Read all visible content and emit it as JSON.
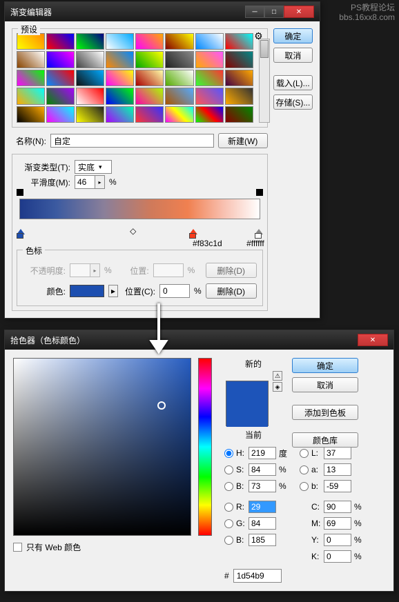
{
  "watermark": {
    "line1": "PS教程论坛",
    "line2": "bbs.16xx8.com"
  },
  "gradient_editor": {
    "title": "渐变编辑器",
    "presets_label": "预设",
    "buttons": {
      "ok": "确定",
      "cancel": "取消",
      "load": "载入(L)...",
      "save": "存储(S)..."
    },
    "name_label": "名称(N):",
    "name_value": "自定",
    "new_button": "新建(W)",
    "type_label": "渐变类型(T):",
    "type_value": "实底",
    "smooth_label": "平滑度(M):",
    "smooth_value": "46",
    "smooth_unit": "%",
    "stops_label": "色标",
    "annotations": {
      "red": "#f83c1d",
      "white": "#ffffff"
    },
    "opacity_label": "不透明度:",
    "opacity_unit": "%",
    "position_label": "位置:",
    "position_unit": "%",
    "delete1": "删除(D)",
    "color_label": "颜色:",
    "color_value": "#1d4fb0",
    "location_label": "位置(C):",
    "location_value": "0",
    "location_unit": "%",
    "delete2": "删除(D)",
    "preset_colors": [
      "linear-gradient(45deg,#ff0,#f80)",
      "linear-gradient(45deg,#f00,#00f)",
      "linear-gradient(45deg,#0f0,#008)",
      "linear-gradient(45deg,#fff,#0af)",
      "linear-gradient(45deg,#f0f,#fa0)",
      "linear-gradient(45deg,#800,#ff0)",
      "linear-gradient(45deg,#08f,#fff)",
      "linear-gradient(45deg,#f00,#0ff)",
      "linear-gradient(45deg,#840,#fff)",
      "linear-gradient(45deg,#00f,#f0f)",
      "linear-gradient(45deg,#444,#fff)",
      "linear-gradient(45deg,#f80,#08f)",
      "linear-gradient(45deg,#0a0,#ff0)",
      "linear-gradient(45deg,#222,#888)",
      "linear-gradient(45deg,#fa0,#f5f)",
      "linear-gradient(45deg,#800,#088)",
      "linear-gradient(45deg,#f0f,#0f0)",
      "linear-gradient(45deg,#08f,#f00)",
      "linear-gradient(45deg,#111,#0af)",
      "linear-gradient(45deg,#f0f,#ff0)",
      "linear-gradient(45deg,#a00,#ffa)",
      "linear-gradient(45deg,#5a0,#fff)",
      "linear-gradient(45deg,#3f3,#f33)",
      "linear-gradient(45deg,#404,#fa0)",
      "linear-gradient(45deg,#fa0,#0ff)",
      "linear-gradient(45deg,#080,#a0f)",
      "linear-gradient(45deg,#fff,#f00)",
      "linear-gradient(45deg,#00f,#0f0)",
      "linear-gradient(45deg,#f0a,#af0)",
      "linear-gradient(45deg,#a50,#5af)",
      "linear-gradient(45deg,#f55,#55f)",
      "linear-gradient(45deg,#fa0,#333)",
      "linear-gradient(45deg,#000,#fa0)",
      "linear-gradient(45deg,#f0f,#0ff)",
      "linear-gradient(45deg,#ff0,#222)",
      "linear-gradient(45deg,#a0f,#0fa)",
      "linear-gradient(45deg,#f33,#33f)",
      "linear-gradient(45deg,#f0f,#ff0,#0ff)",
      "linear-gradient(45deg,#0f0,#f00,#00f)",
      "linear-gradient(45deg,#800,#080)"
    ]
  },
  "color_picker": {
    "title": "拾色器（色标颜色）",
    "new_label": "新的",
    "current_label": "当前",
    "buttons": {
      "ok": "确定",
      "cancel": "取消",
      "add": "添加到色板",
      "lib": "颜色库"
    },
    "hsb": {
      "h": {
        "label": "H:",
        "value": "219",
        "unit": "度"
      },
      "s": {
        "label": "S:",
        "value": "84",
        "unit": "%"
      },
      "b": {
        "label": "B:",
        "value": "73",
        "unit": "%"
      }
    },
    "lab": {
      "l": {
        "label": "L:",
        "value": "37"
      },
      "a": {
        "label": "a:",
        "value": "13"
      },
      "b": {
        "label": "b:",
        "value": "-59"
      }
    },
    "rgb": {
      "r": {
        "label": "R:",
        "value": "29"
      },
      "g": {
        "label": "G:",
        "value": "84"
      },
      "b": {
        "label": "B:",
        "value": "185"
      }
    },
    "cmyk": {
      "c": {
        "label": "C:",
        "value": "90",
        "unit": "%"
      },
      "m": {
        "label": "M:",
        "value": "69",
        "unit": "%"
      },
      "y": {
        "label": "Y:",
        "value": "0",
        "unit": "%"
      },
      "k": {
        "label": "K:",
        "value": "0",
        "unit": "%"
      }
    },
    "hex_label": "#",
    "hex_value": "1d54b9",
    "web_only": "只有 Web 颜色"
  }
}
